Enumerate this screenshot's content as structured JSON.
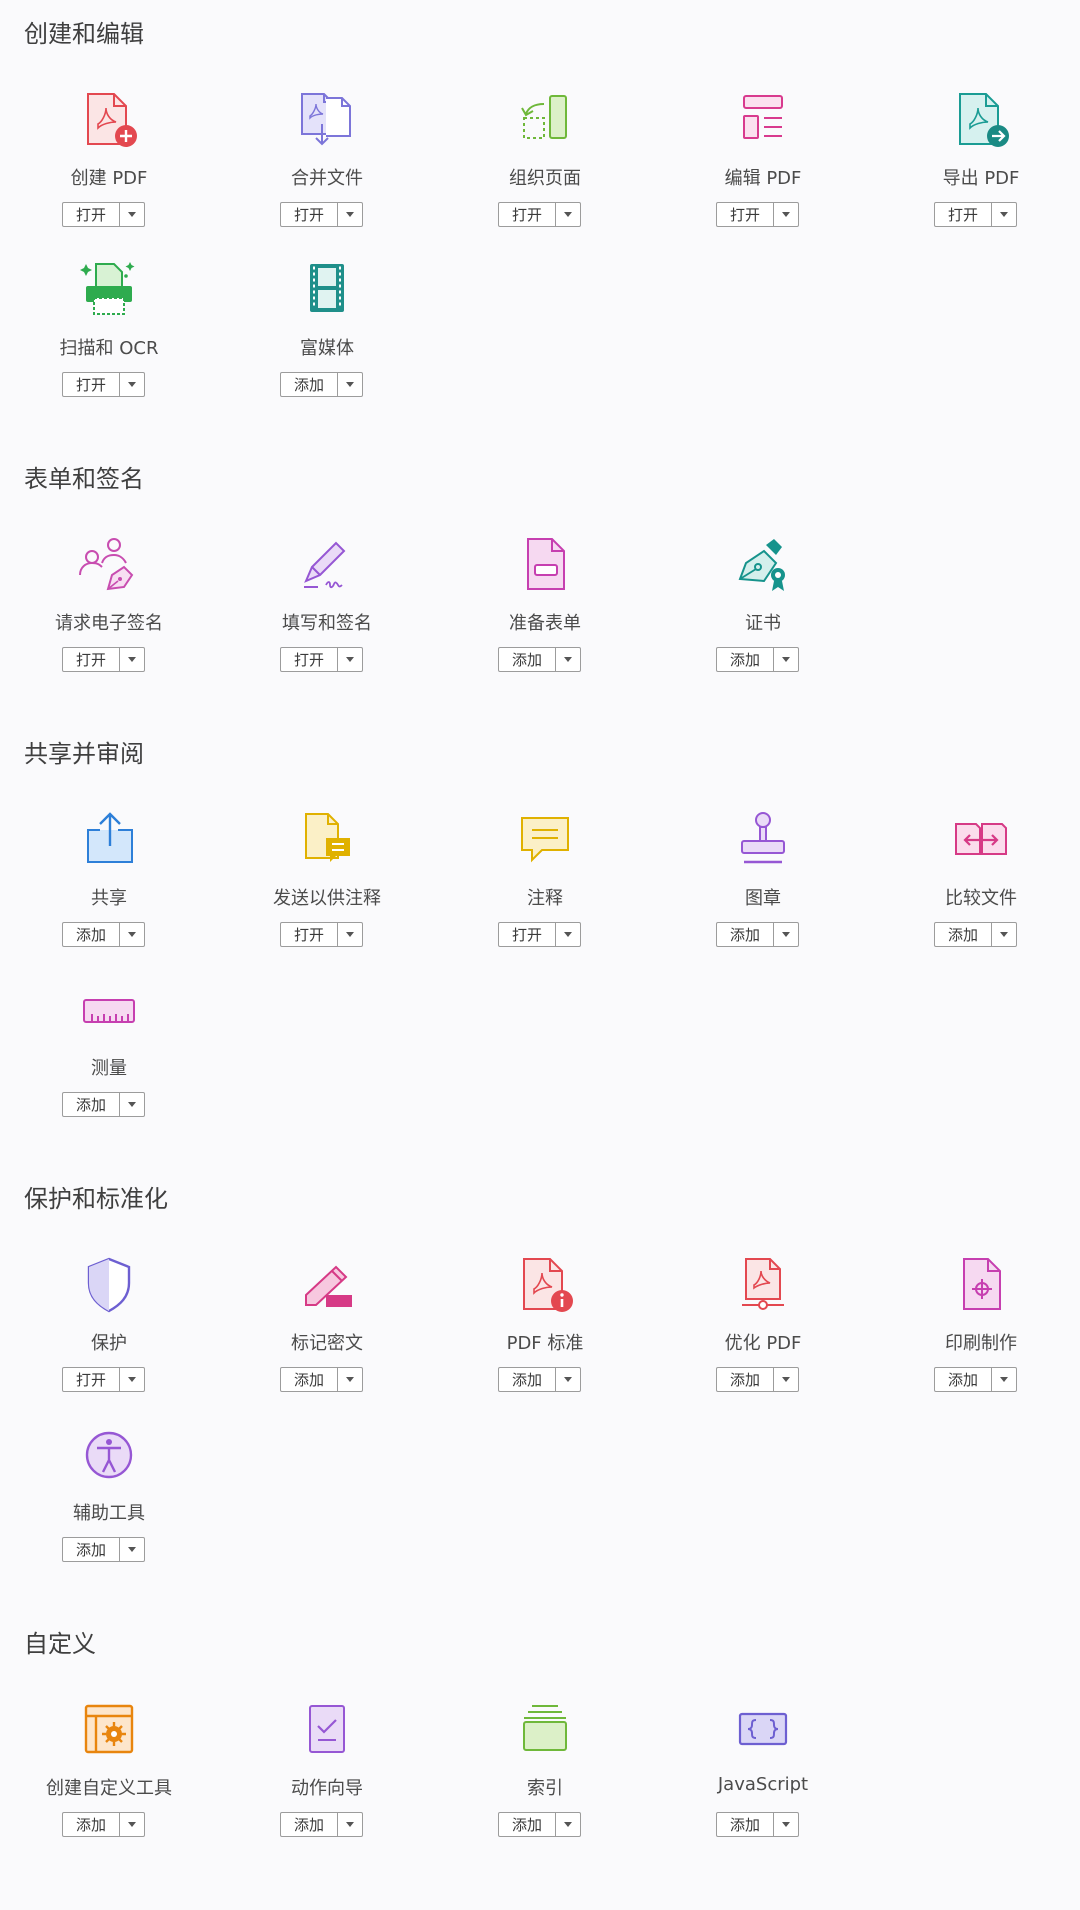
{
  "sections": [
    {
      "title": "创建和编辑",
      "tools": [
        {
          "name": "创建 PDF",
          "button": "打开",
          "icon": "create-pdf-icon"
        },
        {
          "name": "合并文件",
          "button": "打开",
          "icon": "combine-files-icon"
        },
        {
          "name": "组织页面",
          "button": "打开",
          "icon": "organize-pages-icon"
        },
        {
          "name": "编辑 PDF",
          "button": "打开",
          "icon": "edit-pdf-icon"
        },
        {
          "name": "导出 PDF",
          "button": "打开",
          "icon": "export-pdf-icon"
        },
        {
          "name": "扫描和 OCR",
          "button": "打开",
          "icon": "scan-ocr-icon"
        },
        {
          "name": "富媒体",
          "button": "添加",
          "icon": "rich-media-icon"
        }
      ]
    },
    {
      "title": "表单和签名",
      "tools": [
        {
          "name": "请求电子签名",
          "button": "打开",
          "icon": "request-esign-icon"
        },
        {
          "name": "填写和签名",
          "button": "打开",
          "icon": "fill-sign-icon"
        },
        {
          "name": "准备表单",
          "button": "添加",
          "icon": "prepare-form-icon"
        },
        {
          "name": "证书",
          "button": "添加",
          "icon": "certificate-icon"
        }
      ]
    },
    {
      "title": "共享并审阅",
      "tools": [
        {
          "name": "共享",
          "button": "添加",
          "icon": "share-icon"
        },
        {
          "name": "发送以供注释",
          "button": "打开",
          "icon": "send-comment-icon"
        },
        {
          "name": "注释",
          "button": "打开",
          "icon": "comment-icon"
        },
        {
          "name": "图章",
          "button": "添加",
          "icon": "stamp-icon"
        },
        {
          "name": "比较文件",
          "button": "添加",
          "icon": "compare-files-icon"
        },
        {
          "name": "测量",
          "button": "添加",
          "icon": "measure-icon"
        }
      ]
    },
    {
      "title": "保护和标准化",
      "tools": [
        {
          "name": "保护",
          "button": "打开",
          "icon": "protect-shield-icon"
        },
        {
          "name": "标记密文",
          "button": "添加",
          "icon": "redact-icon"
        },
        {
          "name": "PDF 标准",
          "button": "添加",
          "icon": "pdf-standards-icon"
        },
        {
          "name": "优化 PDF",
          "button": "添加",
          "icon": "optimize-pdf-icon"
        },
        {
          "name": "印刷制作",
          "button": "添加",
          "icon": "print-production-icon"
        },
        {
          "name": "辅助工具",
          "button": "添加",
          "icon": "accessibility-icon"
        }
      ]
    },
    {
      "title": "自定义",
      "tools": [
        {
          "name": "创建自定义工具",
          "button": "添加",
          "icon": "custom-tool-icon"
        },
        {
          "name": "动作向导",
          "button": "添加",
          "icon": "action-wizard-icon"
        },
        {
          "name": "索引",
          "button": "添加",
          "icon": "index-icon"
        },
        {
          "name": "JavaScript",
          "button": "添加",
          "icon": "javascript-icon"
        }
      ]
    }
  ]
}
